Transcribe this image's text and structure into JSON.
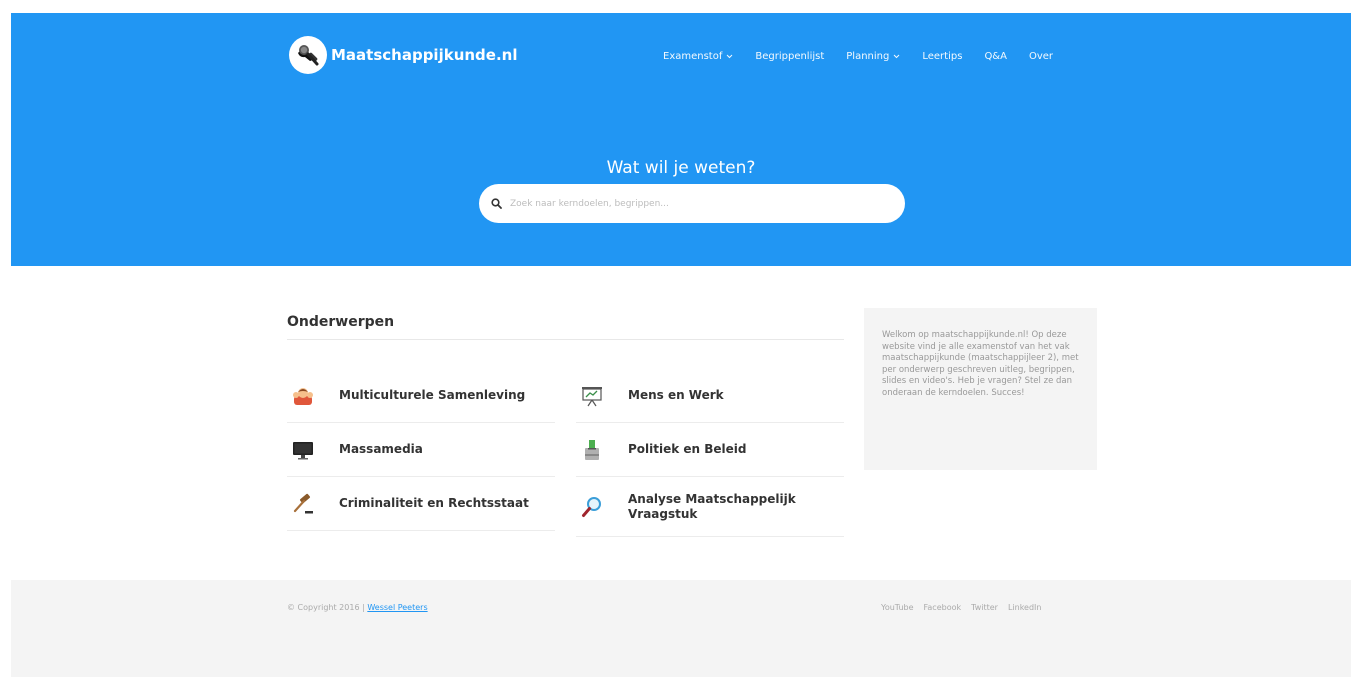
{
  "brand": {
    "name": "Maatschappijkunde.nl",
    "color": "#2196f3"
  },
  "nav": {
    "items": [
      {
        "label": "Examenstof"
      },
      {
        "label": "Begrippenlijst"
      },
      {
        "label": "Planning"
      },
      {
        "label": "Leertips"
      },
      {
        "label": "Q&A"
      },
      {
        "label": "Over"
      }
    ]
  },
  "hero": {
    "title": "Wat wil je weten?",
    "search_placeholder": "Zoek naar kerndoelen, begrippen..."
  },
  "topics": {
    "title": "Onderwerpen",
    "items": [
      {
        "label": "Multiculturele Samenleving",
        "icon": "people-icon"
      },
      {
        "label": "Mens en Werk",
        "icon": "presentation-board-icon"
      },
      {
        "label": "Massamedia",
        "icon": "monitor-icon"
      },
      {
        "label": "Politiek en Beleid",
        "icon": "ballot-box-icon"
      },
      {
        "label": "Criminaliteit en Rechtsstaat",
        "icon": "gavel-icon"
      },
      {
        "label": "Analyse Maatschappelijk Vraagstuk",
        "icon": "magnifier-icon"
      }
    ]
  },
  "sidebar": {
    "text": "Welkom op maatschappijkunde.nl! Op deze website vind je alle examenstof van het vak maatschappijkunde (maatschappijleer 2), met per onderwerp geschreven uitleg, begrippen, slides en video's. Heb je vragen? Stel ze dan onderaan de kerndoelen. Succes!"
  },
  "footer": {
    "copyright": "© Copyright 2016 | ",
    "author": "Wessel Peeters",
    "links": [
      {
        "label": "YouTube"
      },
      {
        "label": "Facebook"
      },
      {
        "label": "Twitter"
      },
      {
        "label": "LinkedIn"
      }
    ]
  }
}
